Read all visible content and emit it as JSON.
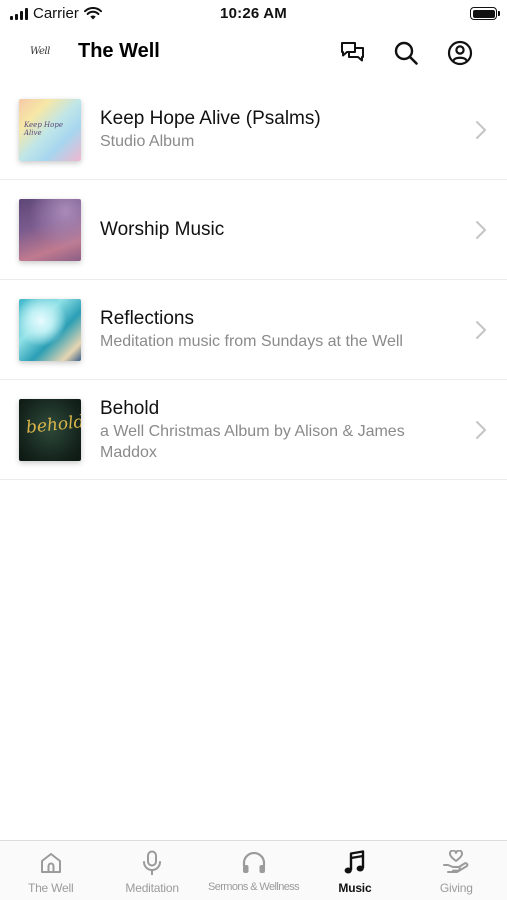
{
  "status_bar": {
    "carrier": "Carrier",
    "time": "10:26 AM"
  },
  "header": {
    "logo_text": "Well",
    "title": "The Well",
    "icons": [
      "chat-icon",
      "search-icon",
      "account-icon"
    ]
  },
  "albums": [
    {
      "title": "Keep Hope Alive (Psalms)",
      "subtitle": "Studio Album",
      "art_text": "Keep Hope Alive"
    },
    {
      "title": "Worship Music",
      "subtitle": ""
    },
    {
      "title": "Reflections",
      "subtitle": "Meditation music from Sundays at the Well"
    },
    {
      "title": "Behold",
      "subtitle": "a Well Christmas Album by Alison & James Maddox",
      "art_text": "behold"
    }
  ],
  "tab_bar": {
    "tabs": [
      {
        "label": "The Well",
        "icon": "home-icon",
        "active": false
      },
      {
        "label": "Meditation",
        "icon": "microphone-icon",
        "active": false
      },
      {
        "label": "Sermons & Wellness",
        "icon": "headphones-icon",
        "active": false
      },
      {
        "label": "Music",
        "icon": "music-note-icon",
        "active": true
      },
      {
        "label": "Giving",
        "icon": "giving-hand-icon",
        "active": false
      }
    ],
    "active_color": "#111111",
    "inactive_color": "#9b9b9b"
  }
}
